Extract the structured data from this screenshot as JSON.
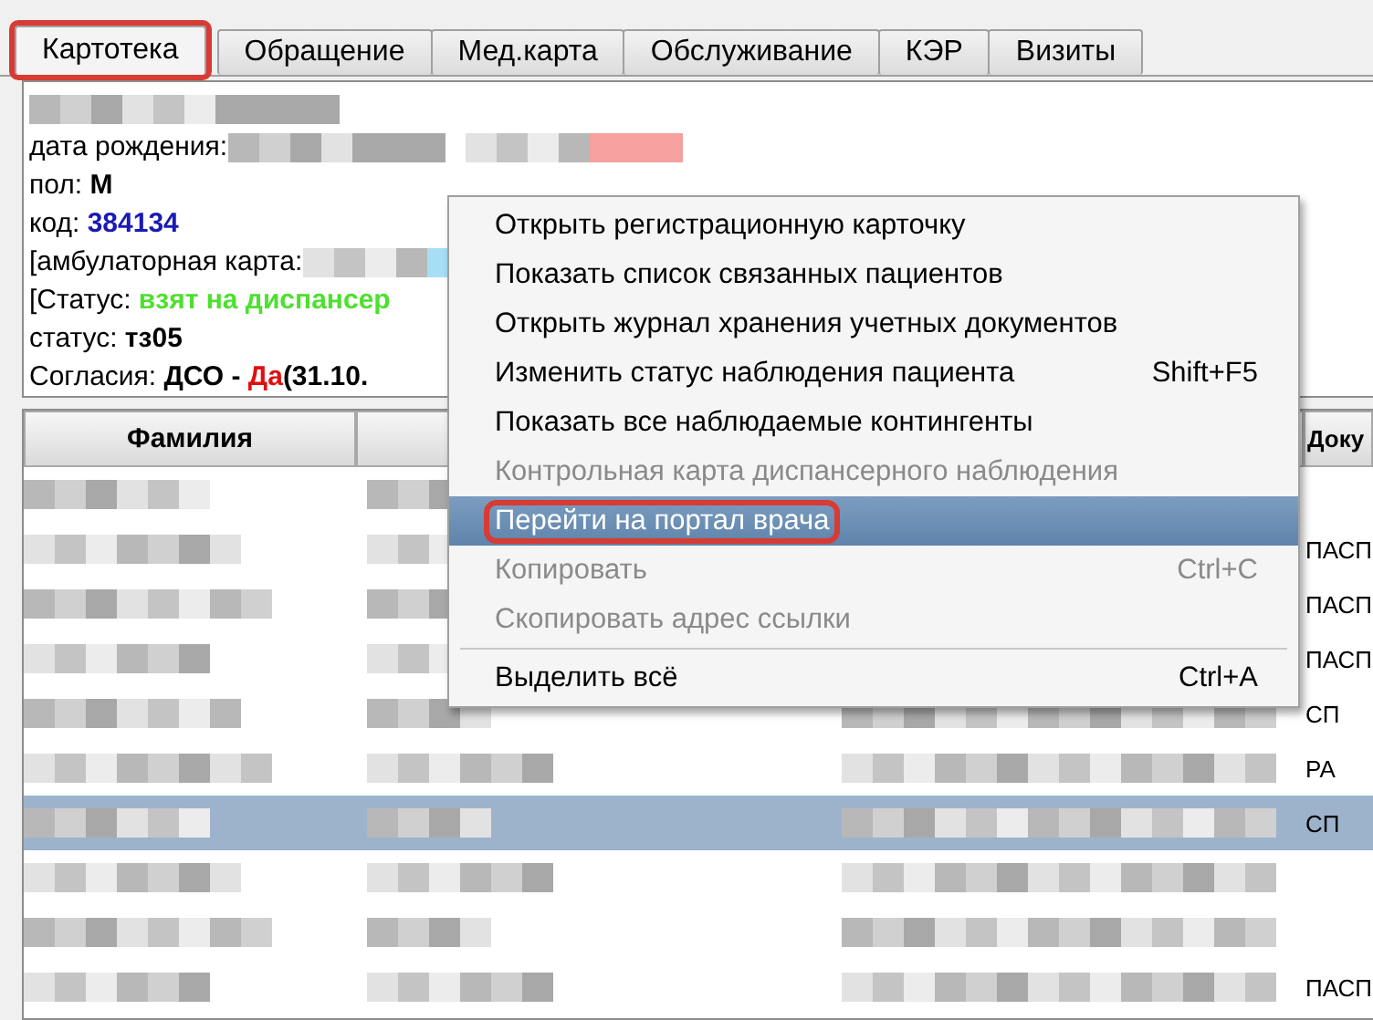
{
  "tabs": [
    {
      "label": "Картотека",
      "selected": true,
      "highlighted": true
    },
    {
      "label": "Обращение",
      "selected": false,
      "highlighted": false
    },
    {
      "label": "Мед.карта",
      "selected": false,
      "highlighted": false
    },
    {
      "label": "Обслуживание",
      "selected": false,
      "highlighted": false
    },
    {
      "label": "КЭР",
      "selected": false,
      "highlighted": false
    },
    {
      "label": "Визиты",
      "selected": false,
      "highlighted": false
    }
  ],
  "patient_info": [
    {
      "parts": [
        {
          "kind": "blur",
          "color": "#a8a8a8"
        }
      ]
    },
    {
      "parts": [
        {
          "kind": "text",
          "text": "дата рождения:"
        },
        {
          "kind": "blur",
          "color": "#a8a8a8"
        },
        {
          "kind": "blur",
          "color": "#f6a0a0"
        }
      ]
    },
    {
      "parts": [
        {
          "kind": "text",
          "text": "пол: "
        },
        {
          "kind": "text",
          "text": "M",
          "bold": true
        }
      ]
    },
    {
      "parts": [
        {
          "kind": "text",
          "text": "код: "
        },
        {
          "kind": "text",
          "text": "384134",
          "bold": true,
          "color": "#1a1ab4"
        }
      ]
    },
    {
      "parts": [
        {
          "kind": "text",
          "text": "[амбулаторная карта:"
        },
        {
          "kind": "blur",
          "color": "#a6def6"
        }
      ]
    },
    {
      "parts": [
        {
          "kind": "text",
          "text": "[Статус: "
        },
        {
          "kind": "text",
          "text": "взят на диспансер",
          "bold": true,
          "color": "#4ee030"
        }
      ]
    },
    {
      "parts": [
        {
          "kind": "text",
          "text": "статус: "
        },
        {
          "kind": "text",
          "text": "тз05",
          "bold": true
        }
      ]
    },
    {
      "parts": [
        {
          "kind": "text",
          "text": "Согласия: "
        },
        {
          "kind": "text",
          "text": "ДСО - ",
          "bold": true
        },
        {
          "kind": "text",
          "text": "Да",
          "bold": true,
          "color": "#e01010"
        },
        {
          "kind": "text",
          "text": "(31.10.",
          "bold": true
        }
      ]
    }
  ],
  "table": {
    "columns": [
      "Фамилия",
      "",
      "Доку"
    ],
    "rows": [
      {
        "selected": false
      },
      {
        "selected": false,
        "column_last": "ПАСП"
      },
      {
        "selected": false,
        "column_last": "ПАСП"
      },
      {
        "selected": false,
        "column_last": "ПАСП"
      },
      {
        "selected": false,
        "column_last": "СП"
      },
      {
        "selected": false,
        "column_last": "РА"
      },
      {
        "selected": true,
        "column_last": "СП"
      },
      {
        "selected": false
      },
      {
        "selected": false
      },
      {
        "selected": false,
        "column_last": "ПАСП"
      }
    ]
  },
  "context_menu": [
    {
      "kind": "item",
      "label": "Открыть регистрационную карточку",
      "disabled": false,
      "selected": false,
      "highlighted": false
    },
    {
      "kind": "item",
      "label": "Показать список связанных пациентов",
      "disabled": false,
      "selected": false,
      "highlighted": false
    },
    {
      "kind": "item",
      "label": "Открыть журнал хранения учетных документов",
      "disabled": false,
      "selected": false,
      "highlighted": false
    },
    {
      "kind": "item",
      "label": "Изменить статус наблюдения пациента",
      "shortcut": "Shift+F5",
      "disabled": false,
      "selected": false,
      "highlighted": false
    },
    {
      "kind": "item",
      "label": "Показать все наблюдаемые контингенты",
      "disabled": false,
      "selected": false,
      "highlighted": false
    },
    {
      "kind": "item",
      "label": "Контрольная карта диспансерного наблюдения",
      "disabled": true,
      "selected": false,
      "highlighted": false
    },
    {
      "kind": "item",
      "label": "Перейти на портал врача",
      "disabled": false,
      "selected": true,
      "highlighted": true
    },
    {
      "kind": "item",
      "label": "Копировать",
      "shortcut": "Ctrl+C",
      "disabled": true,
      "selected": false,
      "highlighted": false
    },
    {
      "kind": "item",
      "label": "Скопировать адрес ссылки",
      "disabled": true,
      "selected": false,
      "highlighted": false
    },
    {
      "kind": "separator"
    },
    {
      "kind": "item",
      "label": "Выделить всё",
      "shortcut": "Ctrl+A",
      "disabled": false,
      "selected": false,
      "highlighted": false
    }
  ]
}
